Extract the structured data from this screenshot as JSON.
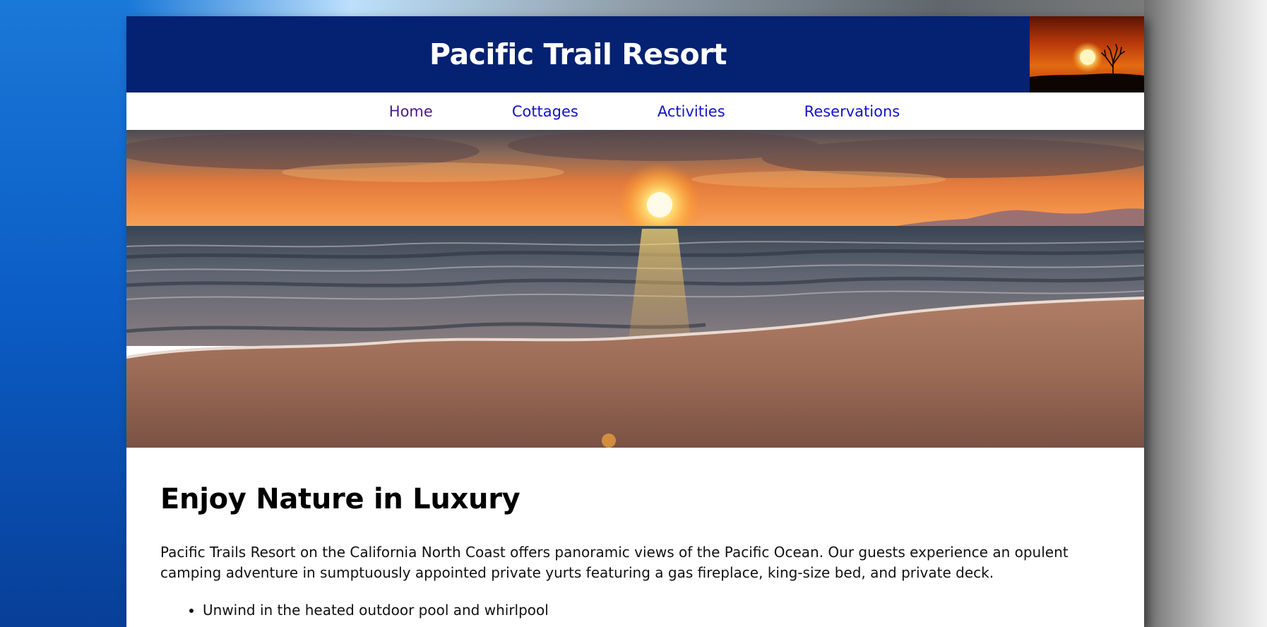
{
  "header": {
    "title": "Pacific Trail Resort",
    "thumb_icon": "sunset-tree-thumbnail"
  },
  "nav": {
    "items": [
      {
        "label": "Home",
        "visited": true
      },
      {
        "label": "Cottages",
        "visited": false
      },
      {
        "label": "Activities",
        "visited": false
      },
      {
        "label": "Reservations",
        "visited": false
      }
    ]
  },
  "hero": {
    "image": "beach-sunset-photo"
  },
  "main": {
    "heading": "Enjoy Nature in Luxury",
    "paragraph": "Pacific Trails Resort on the California North Coast offers panoramic views of the Pacific Ocean. Our guests experience an opulent camping adventure in sumptuously appointed private yurts featuring a gas fireplace, king-size bed, and private deck.",
    "list": [
      "Unwind in the heated outdoor pool and whirlpool"
    ]
  },
  "colors": {
    "header_bg": "#052172",
    "link": "#1313c8",
    "link_visited": "#4a1a8a",
    "page_bg": "#ffffff"
  }
}
